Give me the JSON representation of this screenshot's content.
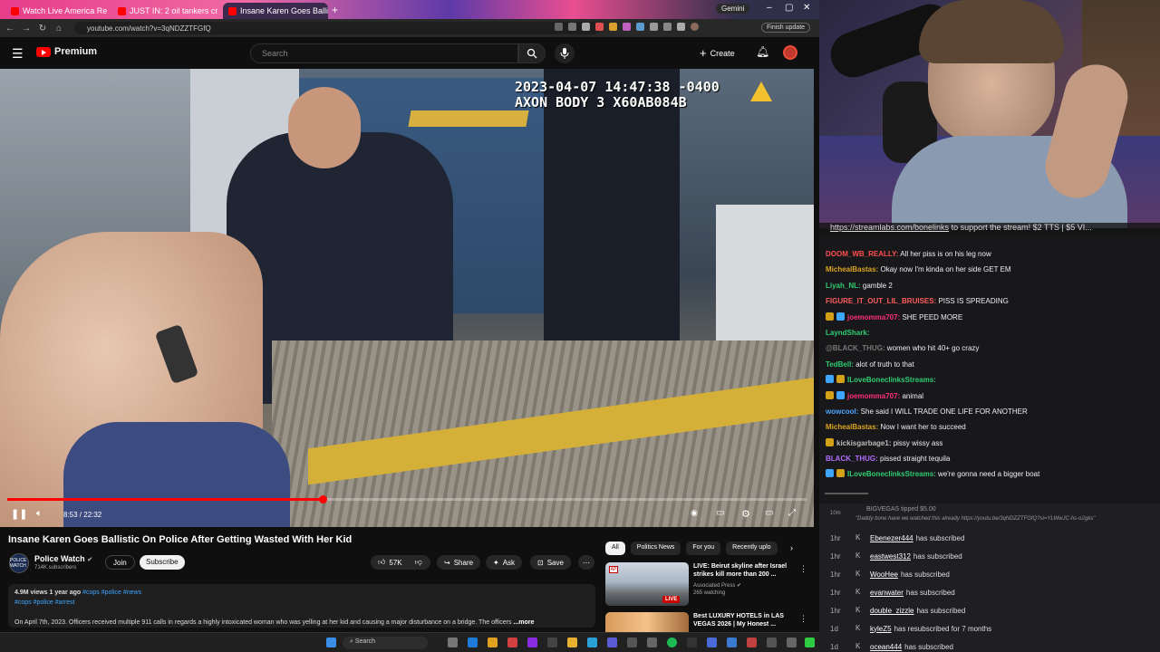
{
  "browser": {
    "tabs": [
      {
        "label": "Watch Live America Reports: Fi"
      },
      {
        "label": "JUST IN: 2 oil tankers cross Str"
      },
      {
        "label": "Insane Karen Goes Ballistic"
      }
    ],
    "gemini_label": "Gemini",
    "url": "youtube.com/watch?v=3qNDZZTFGfQ",
    "finish_update": "Finish update"
  },
  "youtube": {
    "logo_text": "Premium",
    "search_placeholder": "Search",
    "create_label": "Create",
    "video": {
      "timestamp_line1": "2023-04-07 14:47:38 -0400",
      "timestamp_line2": "AXON BODY 3 X60AB084B",
      "time_current": "8:53",
      "time_total": "22:32",
      "time_display": "8:53 / 22:32",
      "progress": 0.395
    },
    "title": "Insane Karen Goes Ballistic On Police After Getting Wasted With Her Kid",
    "channel": {
      "logo_text": "POLICE WATCH",
      "name": "Police Watch",
      "subs": "714K subscribers",
      "join": "Join",
      "subscribe": "Subscribe"
    },
    "actions": {
      "likes": "57K",
      "share": "Share",
      "ask": "Ask",
      "save": "Save"
    },
    "description": {
      "meta": "4.9M views  1 year ago",
      "meta_tags": "#cops #police #news",
      "tags": "#cops #police #arrest",
      "text": "On April 7th, 2023. Officers received multiple 911 calls in regards a highly intoxicated woman who was yelling at her kid and causing a major disturbance on a bridge. The officers",
      "more": "...more"
    },
    "chips": [
      "All",
      "Politics News",
      "For you",
      "Recently uplo"
    ],
    "related": [
      {
        "title": "LIVE: Beirut skyline after Israel strikes kill more than 200 ...",
        "channel": "Associated Press",
        "watching": "265 watching",
        "badge": "LIVE"
      },
      {
        "title": "Best LUXURY HOTELS in LAS VEGAS 2026 | My Honest ...",
        "channel": "",
        "watching": "",
        "badge": ""
      }
    ]
  },
  "taskbar": {
    "search": "Search"
  },
  "stream": {
    "banner_link": "https://streamlabs.com/bonelinks",
    "banner_text": " to support the stream! $2 TTS | $5 VI...",
    "chat": [
      {
        "user": "DOOM_WB_REALLY:",
        "text": " All her piss is on his leg now",
        "color": "#ff4f4f",
        "badges": []
      },
      {
        "user": "MichealBastas:",
        "text": " Okay now I'm kinda on her side GET EM",
        "color": "#daa520",
        "badges": []
      },
      {
        "user": "Liyah_NL:",
        "text": " gamble 2",
        "color": "#2ecc71",
        "badges": []
      },
      {
        "user": "FIGURE_IT_OUT_LIL_BRUISES:",
        "text": " PISS IS SPREADING",
        "color": "#ff5c5c",
        "badges": []
      },
      {
        "user": "joemomma707:",
        "text": " SHE PEED MORE",
        "color": "#ff2e7a",
        "badges": [
          "#d4a017",
          "#3ea6ff"
        ]
      },
      {
        "user": "LayndShark:",
        "text": "",
        "color": "#2ecc71",
        "badges": []
      },
      {
        "user": "@BLACK_THUG:",
        "text": " women who hit 40+ go crazy",
        "color": "#777",
        "badges": []
      },
      {
        "user": "TedBell:",
        "text": " alot of truth to that",
        "color": "#2ecc71",
        "badges": []
      },
      {
        "user": "ILoveBonecIinksStreams:",
        "text": "",
        "color": "#2ecc71",
        "badges": [
          "#3ea6ff",
          "#d4a017"
        ]
      },
      {
        "user": "joemomma707:",
        "text": " animal",
        "color": "#ff2e7a",
        "badges": [
          "#d4a017",
          "#3ea6ff"
        ]
      },
      {
        "user": "wowcool:",
        "text": " She said I WILL TRADE ONE LIFE FOR ANOTHER",
        "color": "#4fa3ff",
        "badges": []
      },
      {
        "user": "MichealBastas:",
        "text": " Now I want her to succeed",
        "color": "#daa520",
        "badges": []
      },
      {
        "user": "kickisgarbage1:",
        "text": " pissy wissy ass",
        "color": "#bbb",
        "badges": [
          "#d4a017"
        ]
      },
      {
        "user": "BLACK_THUG:",
        "text": " pissed straight tequila",
        "color": "#b36bff",
        "badges": []
      },
      {
        "user": "ILoveBonecIinksStreams:",
        "text": " we're gonna need a bigger boat",
        "color": "#2ecc71",
        "badges": [
          "#3ea6ff",
          "#d4a017"
        ]
      }
    ],
    "tip": {
      "time": "10m",
      "text": "BIGVEGAS tipped $5.00",
      "note": "\"Daddy bone have we watched this already https://youtu.be/3qNDZZTFGfQ?si=YLWwJC-hs-o2gks\""
    },
    "events": [
      {
        "time": "1hr",
        "name": "Ebenezer444",
        "text": "has subscribed"
      },
      {
        "time": "1hr",
        "name": "eastwest312",
        "text": "has subscribed"
      },
      {
        "time": "1hr",
        "name": "WooHee",
        "text": "has subscribed"
      },
      {
        "time": "1hr",
        "name": "evanwater",
        "text": "has subscribed"
      },
      {
        "time": "1hr",
        "name": "double_zizzle",
        "text": "has subscribed"
      },
      {
        "time": "1d",
        "name": "kyleZ5",
        "text": "has resubscribed for 7 months"
      },
      {
        "time": "1d",
        "name": "ocean444",
        "text": "has subscribed"
      }
    ]
  }
}
